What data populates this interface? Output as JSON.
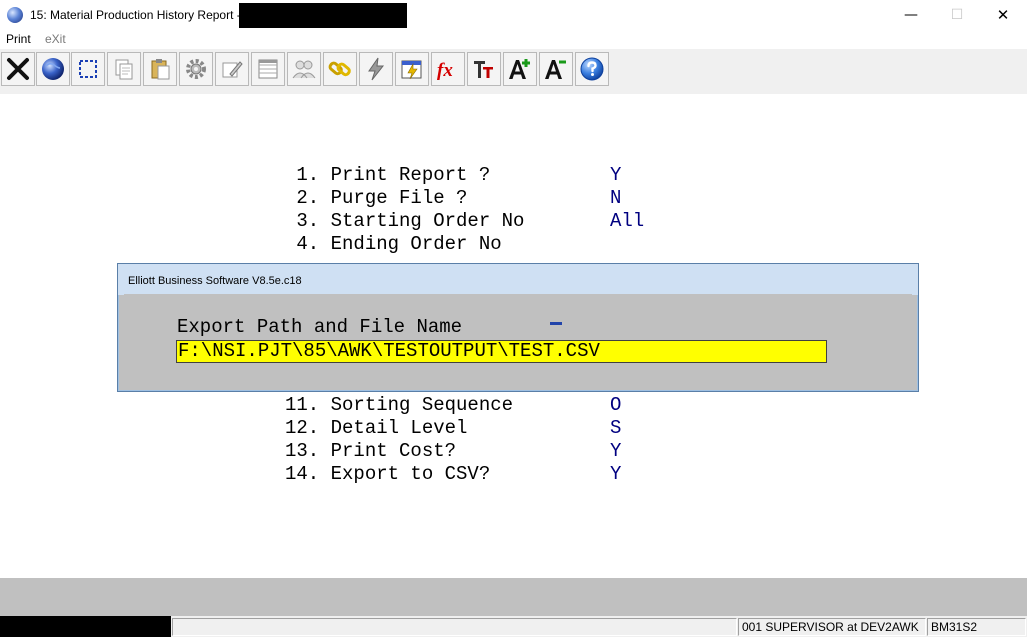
{
  "window": {
    "title": "15: Material Production History Report -",
    "minimize_glyph": "—",
    "maximize_glyph": "☐",
    "close_glyph": "✕"
  },
  "menu": {
    "print": "Print",
    "exit": "eXit"
  },
  "toolbar": {
    "buttons": [
      {
        "icon": "close-x-icon"
      },
      {
        "icon": "globe-icon"
      },
      {
        "icon": "select-rectangle-icon"
      },
      {
        "icon": "copy-icon"
      },
      {
        "icon": "paste-icon"
      },
      {
        "icon": "gear-icon"
      },
      {
        "icon": "edit-icon"
      },
      {
        "icon": "list-icon"
      },
      {
        "icon": "users-icon"
      },
      {
        "icon": "link-icon"
      },
      {
        "icon": "lightning-icon"
      },
      {
        "icon": "calendar-icon"
      },
      {
        "icon": "function-icon"
      },
      {
        "icon": "font-size-icon"
      },
      {
        "icon": "font-increase-icon"
      },
      {
        "icon": "font-decrease-icon"
      },
      {
        "icon": "help-icon"
      }
    ],
    "fx_label": "fx"
  },
  "form": {
    "fields": [
      {
        "label": " 1. Print Report ?",
        "value": "Y"
      },
      {
        "label": " 2. Purge File ?",
        "value": "N"
      },
      {
        "label": " 3. Starting Order No",
        "value": "All"
      },
      {
        "label": " 4. Ending Order No",
        "value": ""
      },
      {
        "label": "11. Sorting Sequence",
        "value": "O"
      },
      {
        "label": "12. Detail Level",
        "value": "S"
      },
      {
        "label": "13. Print Cost?",
        "value": "Y"
      },
      {
        "label": "14. Export to CSV?",
        "value": "Y"
      }
    ]
  },
  "dialog": {
    "title": "Elliott Business Software V8.5e.c18",
    "prompt": "Export Path and File Name",
    "value": "F:\\NSI.PJT\\85\\AWK\\TESTOUTPUT\\TEST.CSV"
  },
  "status": {
    "user": "001 SUPERVISOR at DEV2AWK",
    "program": "BM31S2"
  }
}
